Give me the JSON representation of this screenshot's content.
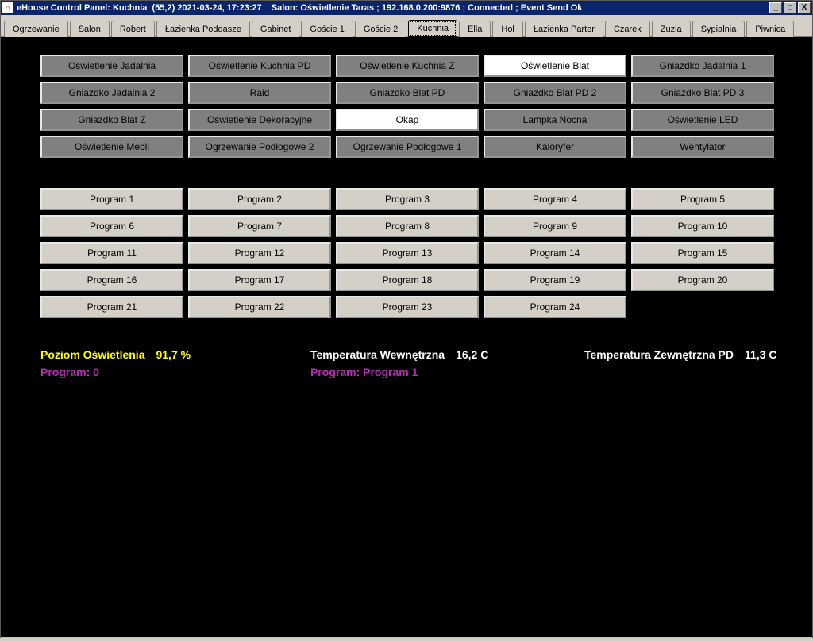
{
  "window": {
    "title_main": "eHouse Control Panel: Kuchnia  (55,2) 2021-03-24, 17:23:27",
    "title_status": "Salon: Oświetlenie Taras ; 192.168.0.200:9876 ; Connected ; Event Send Ok",
    "min": "_",
    "max": "□",
    "close": "X",
    "icon_glyph": "⌂"
  },
  "tabs": [
    {
      "label": "Ogrzewanie",
      "active": false
    },
    {
      "label": "Salon",
      "active": false
    },
    {
      "label": "Robert",
      "active": false
    },
    {
      "label": "Łazienka Poddasze",
      "active": false
    },
    {
      "label": "Gabinet",
      "active": false
    },
    {
      "label": "Goście 1",
      "active": false
    },
    {
      "label": "Goście 2",
      "active": false
    },
    {
      "label": "Kuchnia",
      "active": true
    },
    {
      "label": "Ella",
      "active": false
    },
    {
      "label": "Hol",
      "active": false
    },
    {
      "label": "Łazienka Parter",
      "active": false
    },
    {
      "label": "Czarek",
      "active": false
    },
    {
      "label": "Zuzia",
      "active": false
    },
    {
      "label": "Sypialnia",
      "active": false
    },
    {
      "label": "Piwnica",
      "active": false
    }
  ],
  "devices": [
    {
      "label": "Oświetlenie Jadalnia",
      "on": false
    },
    {
      "label": "Oświetlenie Kuchnia PD",
      "on": false
    },
    {
      "label": "Oświetlenie Kuchnia  Z",
      "on": false
    },
    {
      "label": "Oświetlenie Blat",
      "on": true
    },
    {
      "label": "Gniazdko Jadalnia 1",
      "on": false
    },
    {
      "label": "Gniazdko Jadalnia 2",
      "on": false
    },
    {
      "label": "Raid",
      "on": false
    },
    {
      "label": "Gniazdko Blat PD",
      "on": false
    },
    {
      "label": "Gniazdko Blat PD 2",
      "on": false
    },
    {
      "label": "Gniazdko Blat PD 3",
      "on": false
    },
    {
      "label": "Gniazdko Blat Z",
      "on": false
    },
    {
      "label": "Oświetlenie Dekoracyjne",
      "on": false
    },
    {
      "label": "Okap",
      "on": true
    },
    {
      "label": "Lampka Nocna",
      "on": false
    },
    {
      "label": "Oświetlenie LED",
      "on": false
    },
    {
      "label": "Oświetlenie Mebli",
      "on": false
    },
    {
      "label": "Ogrzewanie Podłogowe 2",
      "on": false
    },
    {
      "label": "Ogrzewanie Podłogowe 1",
      "on": false
    },
    {
      "label": "Kaloryfer",
      "on": false
    },
    {
      "label": "Wentylator",
      "on": false
    }
  ],
  "programs": [
    "Program 1",
    "Program 2",
    "Program 3",
    "Program 4",
    "Program 5",
    "Program 6",
    "Program 7",
    "Program 8",
    "Program 9",
    "Program 10",
    "Program 11",
    "Program 12",
    "Program 13",
    "Program 14",
    "Program 15",
    "Program 16",
    "Program 17",
    "Program 18",
    "Program 19",
    "Program 20",
    "Program 21",
    "Program 22",
    "Program 23",
    "Program 24"
  ],
  "status": {
    "light_label": "Poziom Oświetlenia",
    "light_value": "91,7 %",
    "temp_in_label": "Temperatura Wewnętrzna",
    "temp_in_value": "16,2 C",
    "temp_out_label": "Temperatura Zewnętrzna PD",
    "temp_out_value": "11,3 C",
    "prog_left": "Program: 0",
    "prog_right": "Program: Program 1"
  }
}
